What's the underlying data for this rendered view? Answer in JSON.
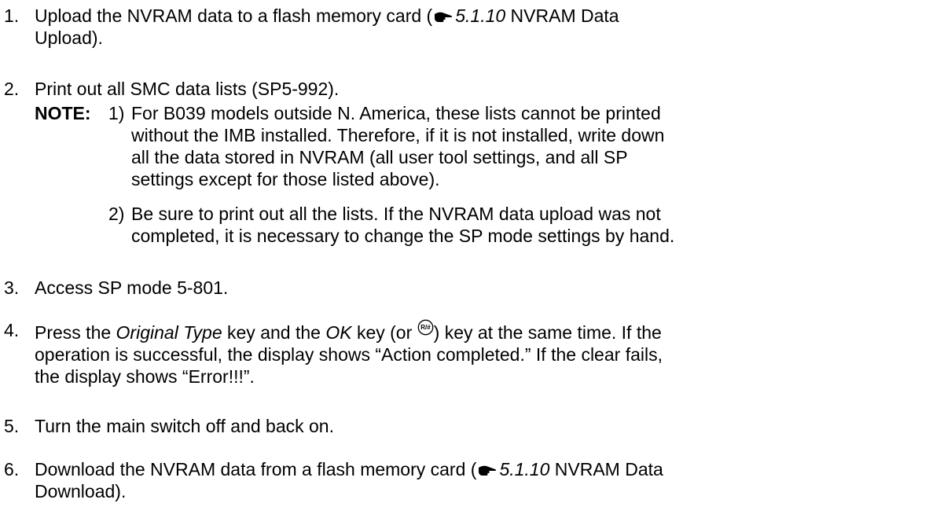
{
  "steps": [
    {
      "num": "1.",
      "pre": "Upload the NVRAM data to a flash memory card (",
      "ref_section": "5.1.10",
      "ref_title": " NVRAM Data",
      "line2": "Upload)."
    },
    {
      "num": "2.",
      "text": "Print out all SMC data lists (SP5-992)."
    },
    {
      "num": "3.",
      "text": "Access SP mode 5-801."
    },
    {
      "num": "4.",
      "pre": "Press the ",
      "key1": "Original Type",
      "mid": " key and the ",
      "key2": "OK",
      "mid2": " key (or ",
      "key_icon_label": "R/#",
      "post": ") key at the same time. If the",
      "line2": "operation is successful, the display shows “Action completed.” If the clear fails,",
      "line3": "the display shows “Error!!!”."
    },
    {
      "num": "5.",
      "text": "Turn the main switch off and back on."
    },
    {
      "num": "6.",
      "pre": "Download the NVRAM data from a flash memory card (",
      "ref_section": "5.1.10",
      "ref_title": " NVRAM Data",
      "line2": "Download)."
    }
  ],
  "note": {
    "label": "NOTE:",
    "items": [
      {
        "num": "1)",
        "lines": [
          "For B039 models outside N. America, these lists cannot be printed",
          "without the IMB installed. Therefore, if it is not installed, write down",
          "all the data stored in NVRAM (all user tool settings, and all SP",
          "settings except for those listed above)."
        ]
      },
      {
        "num": "2)",
        "lines": [
          "Be sure to print out all the lists. If the NVRAM data upload was not",
          "completed, it is necessary to change the SP mode settings by hand."
        ]
      }
    ]
  },
  "icons": {
    "reference": "pointing-hand-icon",
    "key": "r-hash-key-icon"
  }
}
